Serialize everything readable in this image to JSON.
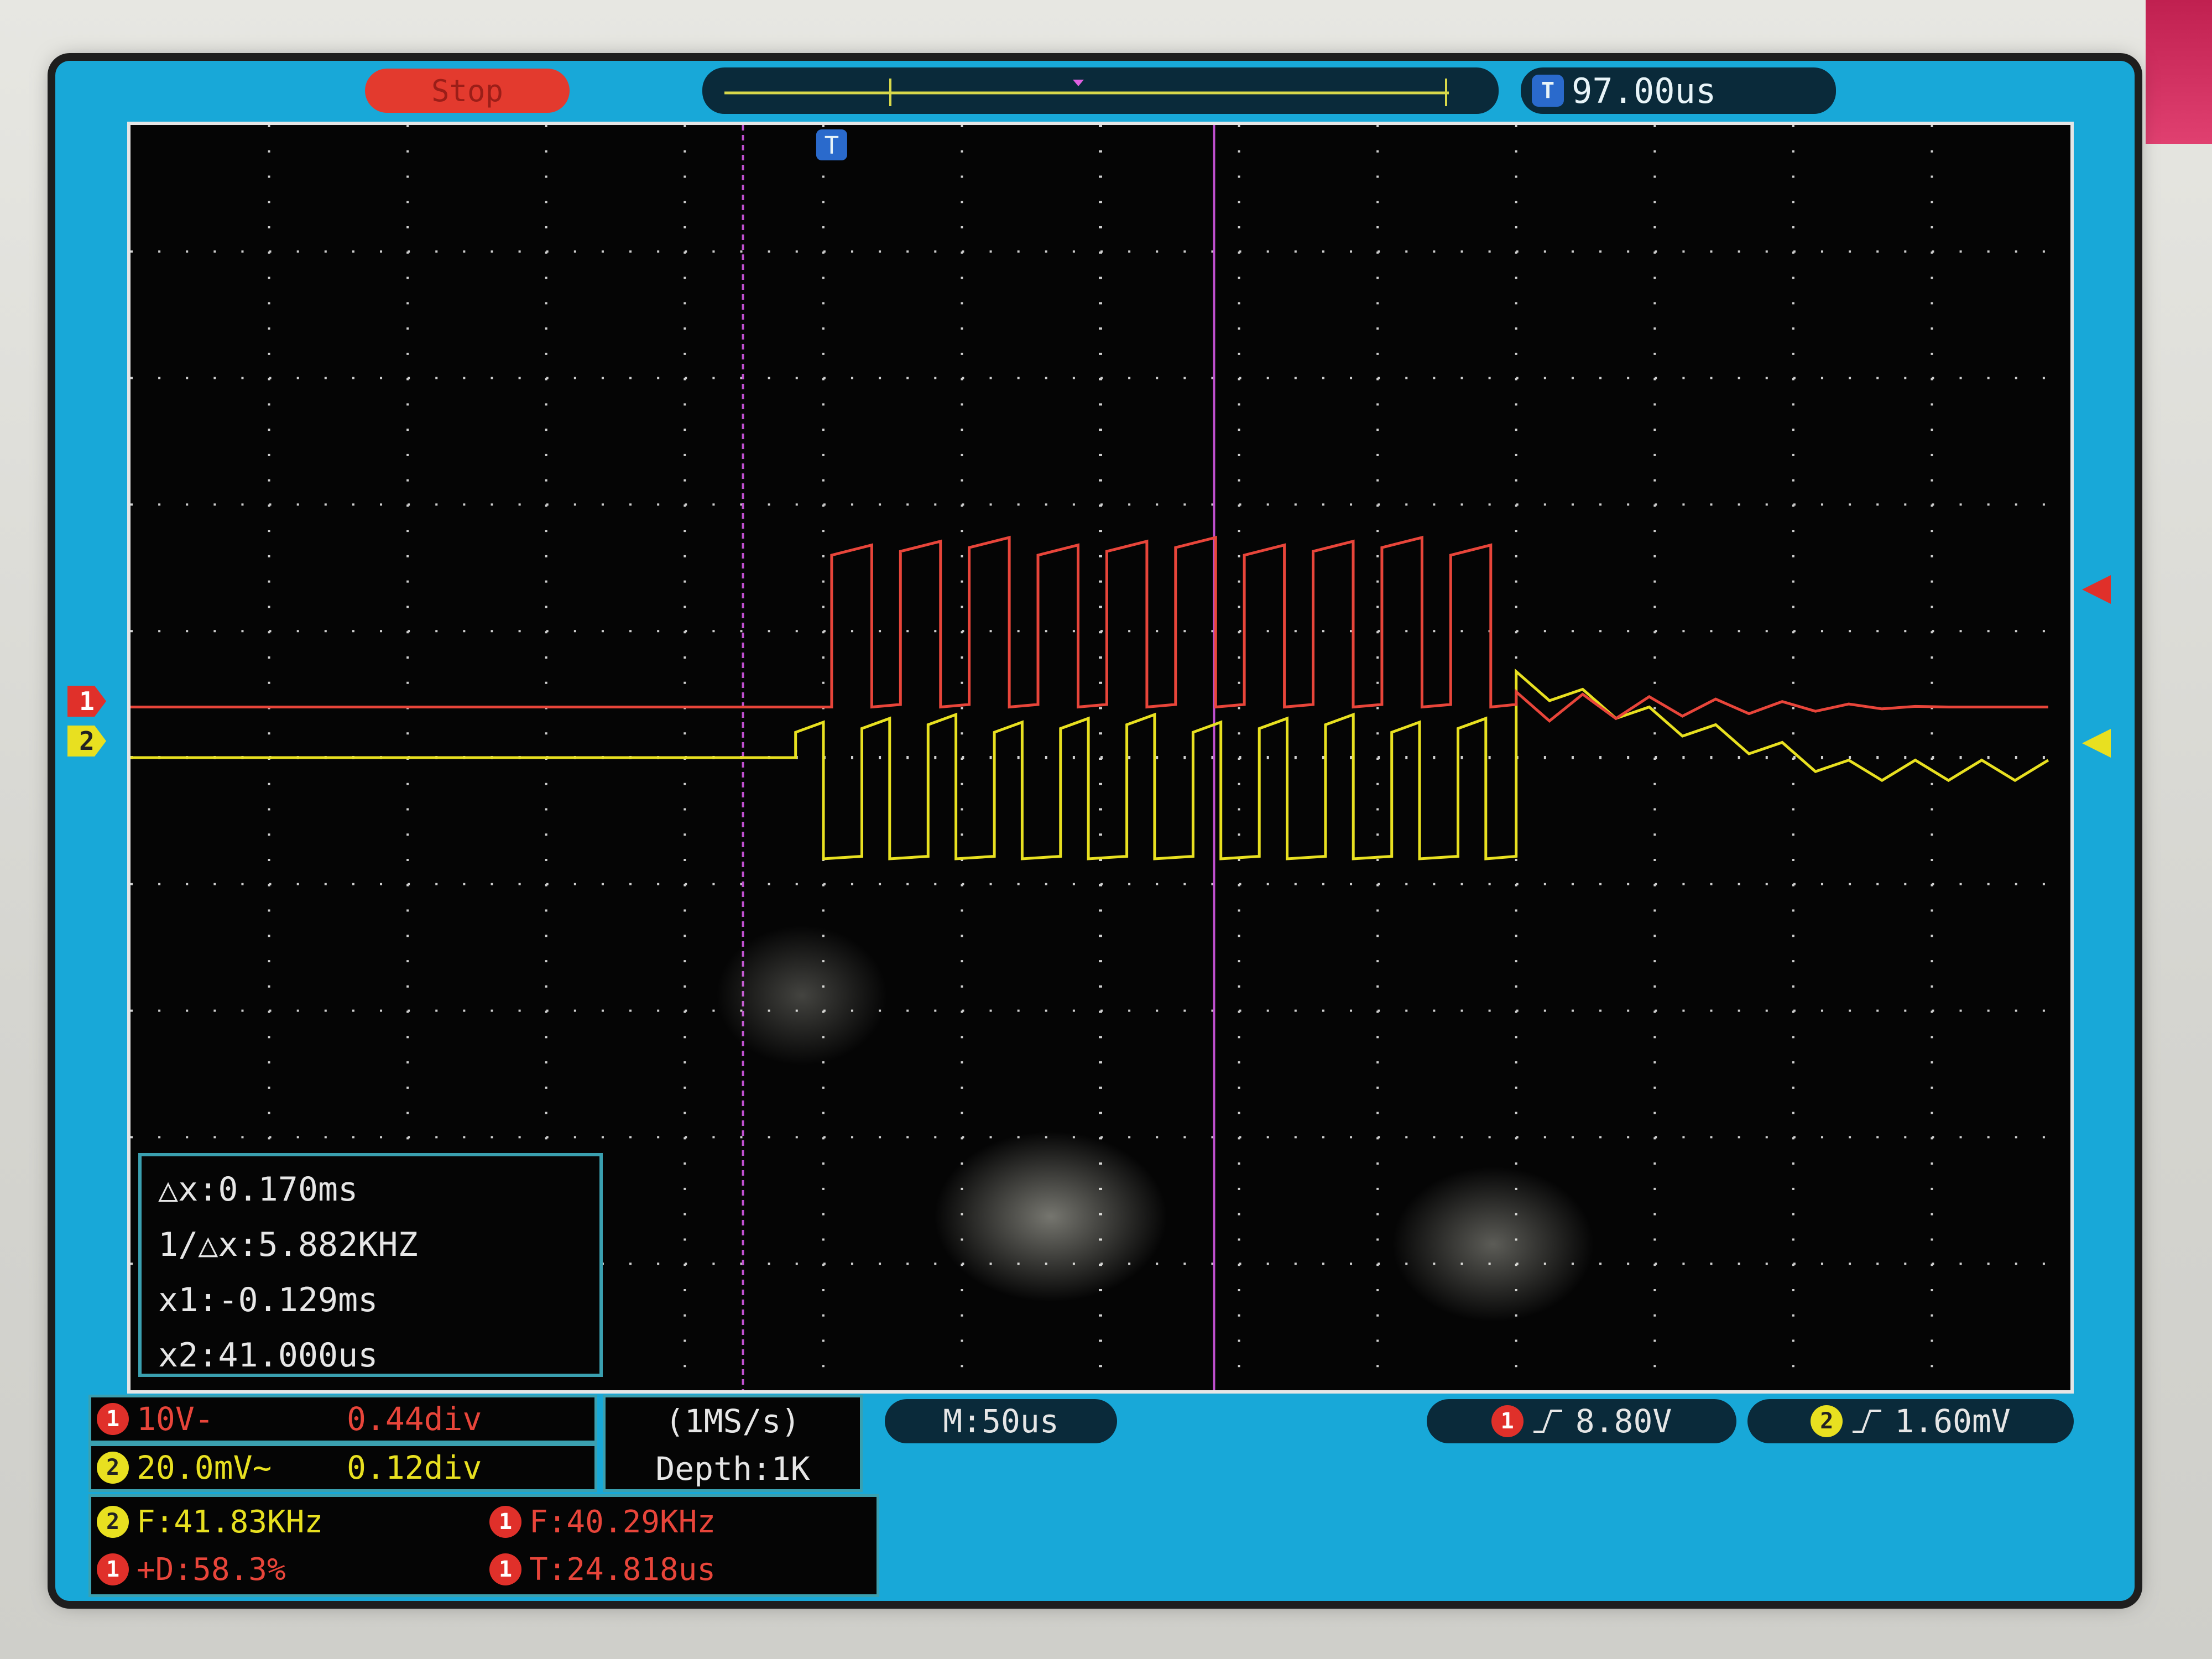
{
  "device": {
    "run_state": "Stop",
    "trigger_position": "97.00us",
    "trigger_badge": "T"
  },
  "cursors": {
    "delta_x": "△x:0.170ms",
    "inv_delta_x": "1/△x:5.882KHZ",
    "x1": "x1:-0.129ms",
    "x2": "x2:41.000us"
  },
  "channels": {
    "ch1": {
      "badge": "1",
      "scale": "10V-",
      "offset": "0.44div",
      "color": "#e8453a"
    },
    "ch2": {
      "badge": "2",
      "scale": "20.0mV~",
      "offset": "0.12div",
      "color": "#e8e020"
    }
  },
  "acquisition": {
    "sample_rate": "(1MS/s)",
    "depth": "Depth:1K",
    "timebase": "M:50us"
  },
  "triggers": {
    "ch1": {
      "badge": "1",
      "edge": "rising",
      "level": "8.80V"
    },
    "ch2": {
      "badge": "2",
      "edge": "rising",
      "level": "1.60mV"
    }
  },
  "measurements": {
    "ch2_freq": {
      "badge": "2",
      "text": "F:41.83KHz"
    },
    "ch1_freq": {
      "badge": "1",
      "text": "F:40.29KHz"
    },
    "ch1_duty": {
      "badge": "1",
      "text": "+D:58.3%"
    },
    "ch1_period": {
      "badge": "1",
      "text": "T:24.818us"
    }
  },
  "chart_data": {
    "type": "line",
    "title": "",
    "xlabel": "",
    "ylabel": "",
    "x_unit": "us",
    "x_range": [
      -350,
      350
    ],
    "x_div": 50,
    "y_div_count": 10,
    "x_div_count": 14,
    "cursors_us": {
      "x1": -129,
      "x2": 41
    },
    "series": [
      {
        "name": "1",
        "color": "#e8453a",
        "description_levels_div": {
          "low": 0.0,
          "high": 1.2
        },
        "burst": {
          "start_us": -97,
          "end_us": 150,
          "period_us": 24.818,
          "duty": 0.583,
          "high_div": 1.2
        },
        "after": {
          "level_div": 0.0
        }
      },
      {
        "name": "2",
        "color": "#e8e020",
        "burst": {
          "start_us": -110,
          "end_us": 150,
          "period_us": 23.9,
          "duty": 0.42,
          "high_div": 0.2,
          "low_div": -0.8
        },
        "tail": {
          "end_us": 270,
          "decay_to_div": -0.1
        }
      }
    ]
  }
}
